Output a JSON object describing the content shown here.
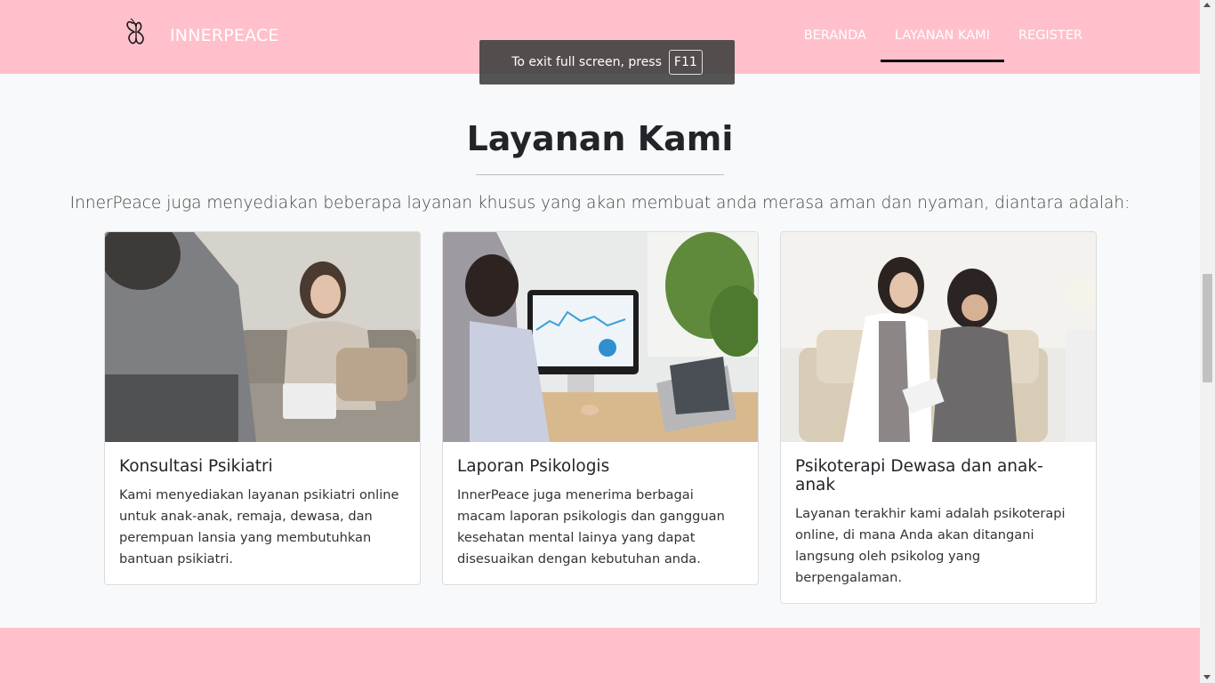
{
  "brand": {
    "name": "INNERPEACE",
    "logo_icon": "butterfly-icon"
  },
  "nav": [
    {
      "label": "BERANDA",
      "active": false
    },
    {
      "label": "LAYANAN KAMI",
      "active": true
    },
    {
      "label": "REGISTER",
      "active": false
    }
  ],
  "fullscreen_toast": {
    "text": "To exit full screen, press",
    "key": "F11"
  },
  "section": {
    "title": "Layanan Kami",
    "lead": "InnerPeace juga menyediakan beberapa layanan khusus yang akan membuat anda merasa aman dan nyaman, diantara adalah:"
  },
  "cards": [
    {
      "title": "Konsultasi Psikiatri",
      "text": "Kami menyediakan layanan psikiatri online untuk anak-anak, remaja, dewasa, dan perempuan lansia yang membutuhkan bantuan psikiatri."
    },
    {
      "title": "Laporan Psikologis",
      "text": "InnerPeace juga menerima berbagai macam laporan psikologis dan gangguan kesehatan mental lainya yang dapat disesuaikan dengan kebutuhan anda."
    },
    {
      "title": "Psikoterapi Dewasa dan anak-anak",
      "text": "Layanan terakhir kami adalah psikoterapi online, di mana Anda akan ditangani langsung oleh psikolog yang berpengalaman."
    }
  ],
  "colors": {
    "navbar": "#ffc0cb",
    "background": "#f8f9fa",
    "active_underline": "#000000"
  }
}
